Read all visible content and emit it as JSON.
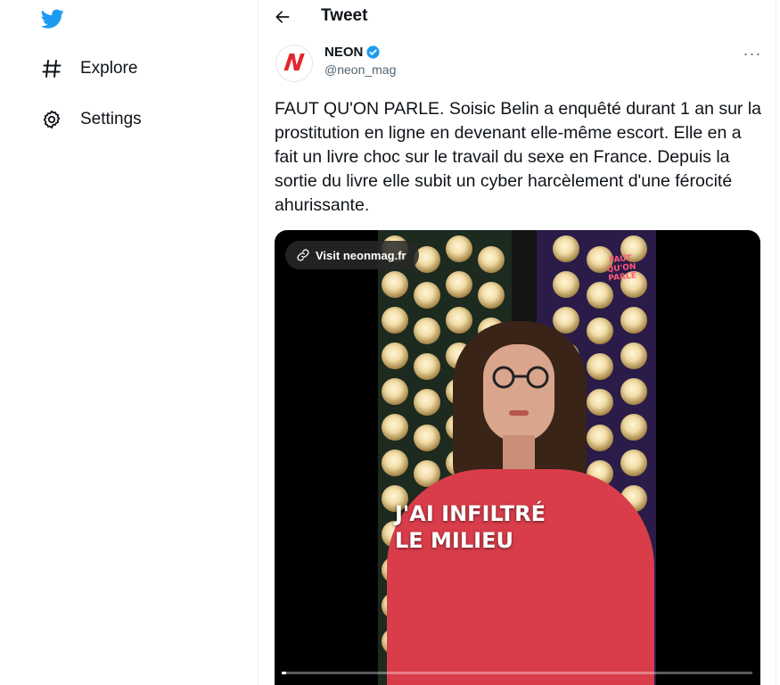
{
  "sidebar": {
    "logo_icon": "twitter-bird-icon",
    "items": [
      {
        "label": "Explore",
        "icon": "hashtag-icon"
      },
      {
        "label": "Settings",
        "icon": "gear-icon"
      }
    ]
  },
  "header": {
    "back_icon": "arrow-left-icon",
    "title": "Tweet"
  },
  "tweet": {
    "author_name": "NEON",
    "author_handle": "@neon_mag",
    "avatar_letter": "N",
    "text": "FAUT QU'ON PARLE. Soisic Belin a enquêté durant 1 an sur la prostitution en ligne en devenant elle-même escort. Elle en a fait un livre choc sur le travail du sexe en France. Depuis la sortie du livre elle subit un cyber harcèlement d'une férocité ahurissante.",
    "more_icon": "more-horizontal-icon"
  },
  "video": {
    "visit_label": "Visit neonmag.fr",
    "caption_line1": "J'AI INFILTRÉ",
    "caption_line2": "LE MILIEU",
    "badge_text": "FAUT QU'ON PARLE",
    "progress": 0.01
  },
  "colors": {
    "accent": "#1d9bf0",
    "brand_red": "#e3262c",
    "sweater": "#d93d4a"
  }
}
